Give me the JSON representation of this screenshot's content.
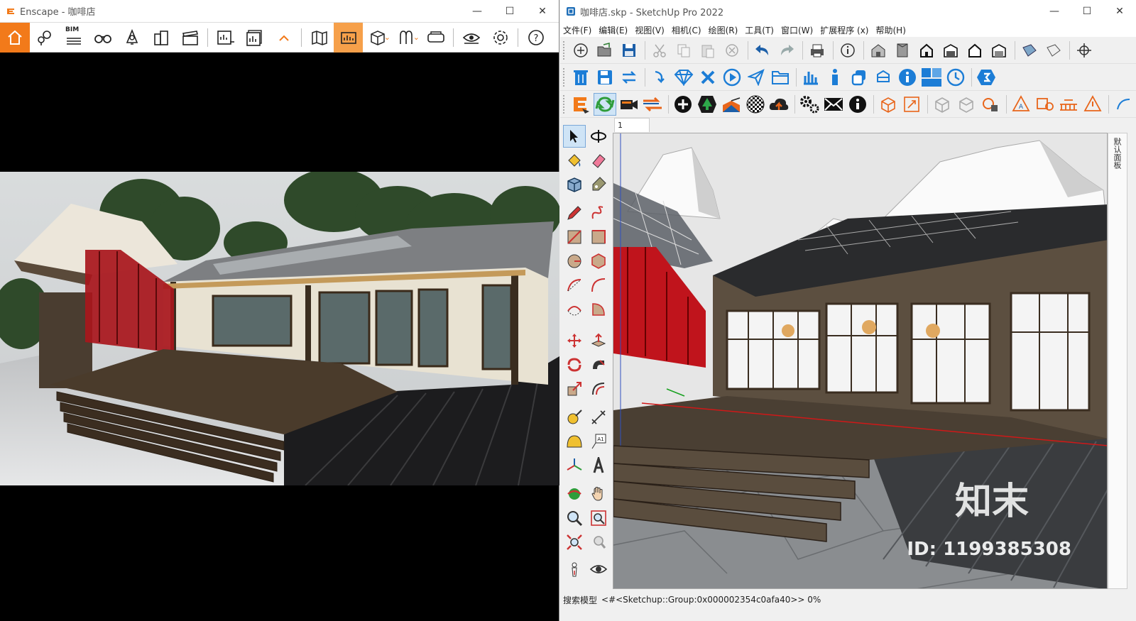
{
  "enscape": {
    "title": "Enscape - 咖啡店",
    "toolbar": {
      "bim_label": "BIM",
      "buttons": [
        "home-icon",
        "location-pin-icon",
        "bim-list-icon",
        "binoculars-icon",
        "bell-icon",
        "buildings-icon",
        "clapper-icon",
        "render-export-icon",
        "batch-render-icon",
        "collapse-up-icon",
        "map-icon",
        "panorama-icon",
        "cube-view-icon",
        "asset-library-icon",
        "vr-headset-icon",
        "eye-icon",
        "gear-icon",
        "help-icon"
      ]
    },
    "colors": {
      "accent": "#f27a1a"
    }
  },
  "sketchup": {
    "title": "咖啡店.skp - SketchUp Pro 2022",
    "menu": [
      "文件(F)",
      "编辑(E)",
      "视图(V)",
      "相机(C)",
      "绘图(R)",
      "工具(T)",
      "窗口(W)",
      "扩展程序 (x)",
      "帮助(H)"
    ],
    "scene_tab": "1",
    "tray_label": "默认面板",
    "status": {
      "label": "搜索模型",
      "text": "<#<Sketchup::Group:0x000002354c0afa40>> 0%"
    }
  },
  "watermark": {
    "logo": "知末",
    "id": "ID: 1199385308"
  }
}
